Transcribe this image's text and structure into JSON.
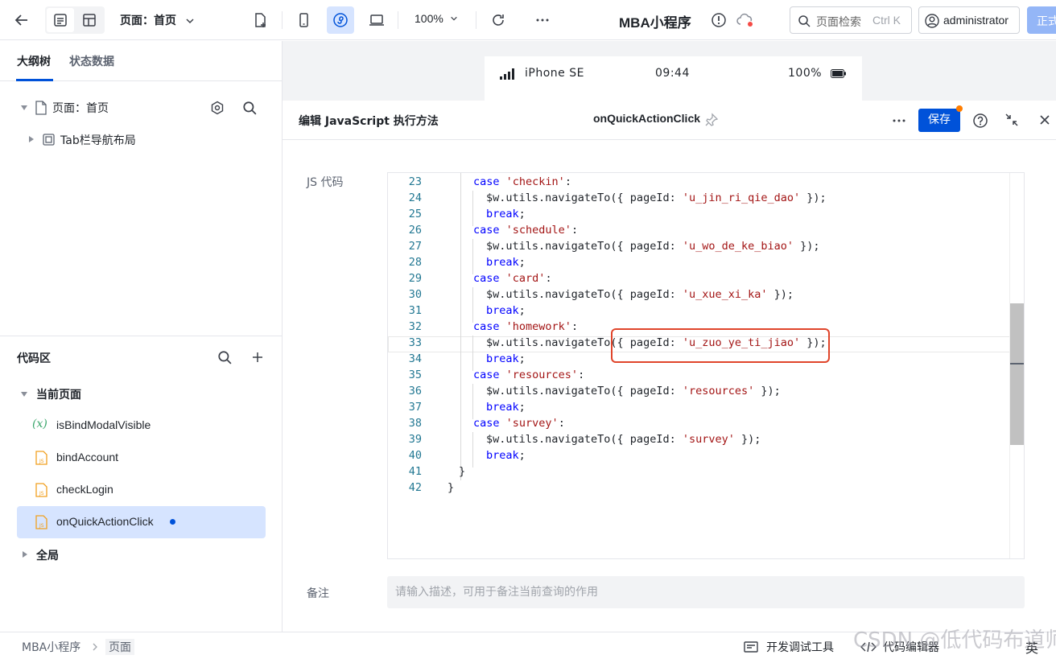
{
  "topbar": {
    "page_selector": "页面：首页",
    "zoom": "100%",
    "app_name": "MBA小程序",
    "search": {
      "placeholder": "页面检索",
      "shortcut": "Ctrl K"
    },
    "user": "administrator",
    "publish_label": "正式"
  },
  "left": {
    "tabs": [
      "大纲树",
      "状态数据"
    ],
    "outline": [
      {
        "label": "页面：首页"
      },
      {
        "label": "Tab栏导航布局"
      }
    ],
    "code_area": {
      "title": "代码区",
      "current_page": "当前页面",
      "items": [
        "isBindModalVisible",
        "bindAccount",
        "checkLogin",
        "onQuickActionClick"
      ],
      "global": "全局"
    }
  },
  "preview": {
    "device": "iPhone SE",
    "time": "09:44",
    "battery": "100%"
  },
  "editor": {
    "title": "编辑 JavaScript 执行方法",
    "function_name": "onQuickActionClick",
    "save_label": "保存",
    "js_code_label": "JS 代码",
    "remark_label": "备注",
    "remark_placeholder": "请输入描述，可用于备注当前查询的作用",
    "line_numbers": [
      "23",
      "24",
      "25",
      "26",
      "27",
      "28",
      "29",
      "30",
      "31",
      "32",
      "33",
      "34",
      "35",
      "36",
      "37",
      "38",
      "39",
      "40",
      "41",
      "42"
    ],
    "code": {
      "l23": {
        "kw": "case",
        "str": "'checkin'",
        "tail": ":"
      },
      "l24": {
        "pre": "$w.utils.navigateTo({ pageId: ",
        "str": "'u_jin_ri_qie_dao'",
        "tail": " });"
      },
      "l25": {
        "kw": "break",
        "tail": ";"
      },
      "l26": {
        "kw": "case",
        "str": "'schedule'",
        "tail": ":"
      },
      "l27": {
        "pre": "$w.utils.navigateTo({ pageId: ",
        "str": "'u_wo_de_ke_biao'",
        "tail": " });"
      },
      "l28": {
        "kw": "break",
        "tail": ";"
      },
      "l29": {
        "kw": "case",
        "str": "'card'",
        "tail": ":"
      },
      "l30": {
        "pre": "$w.utils.navigateTo({ pageId: ",
        "str": "'u_xue_xi_ka'",
        "tail": " });"
      },
      "l31": {
        "kw": "break",
        "tail": ";"
      },
      "l32": {
        "kw": "case",
        "str": "'homework'",
        "tail": ":"
      },
      "l33": {
        "pre": "$w.utils.navigateTo({ pageId: ",
        "str": "'u_zuo_ye_ti_jiao'",
        "tail": " });"
      },
      "l34": {
        "kw": "break",
        "tail": ";"
      },
      "l35": {
        "kw": "case",
        "str": "'resources'",
        "tail": ":"
      },
      "l36": {
        "pre": "$w.utils.navigateTo({ pageId: ",
        "str": "'resources'",
        "tail": " });"
      },
      "l37": {
        "kw": "break",
        "tail": ";"
      },
      "l38": {
        "kw": "case",
        "str": "'survey'",
        "tail": ":"
      },
      "l39": {
        "pre": "$w.utils.navigateTo({ pageId: ",
        "str": "'survey'",
        "tail": " });"
      },
      "l40": {
        "kw": "break",
        "tail": ";"
      },
      "l41": {
        "tail": "}"
      },
      "l42": {
        "tail": "}"
      }
    }
  },
  "bottombar": {
    "breadcrumb": [
      "MBA小程序",
      "页面"
    ],
    "devtools": "开发调试工具",
    "code_editor": "代码编辑器",
    "lang": "英"
  },
  "watermark": "CSDN @低代码布道师",
  "colors": {
    "primary": "#0052d9",
    "accent_dot": "#ff7d00",
    "highlight_box": "#e0452b"
  }
}
